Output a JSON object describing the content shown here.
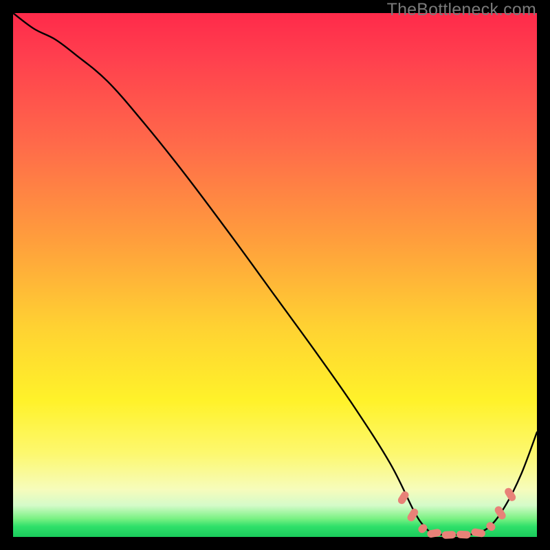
{
  "watermark": "TheBottleneck.com",
  "chart_data": {
    "type": "line",
    "title": "",
    "xlabel": "",
    "ylabel": "",
    "xlim": [
      0,
      100
    ],
    "ylim": [
      0,
      100
    ],
    "grid": false,
    "legend": false,
    "background": "rainbow-gradient-red-to-green",
    "series": [
      {
        "name": "bottleneck-curve",
        "color": "#000000",
        "x": [
          0,
          4,
          8,
          12,
          18,
          25,
          33,
          42,
          50,
          58,
          65,
          72,
          76.5,
          78.5,
          80,
          82,
          85,
          88,
          91,
          94,
          97,
          100
        ],
        "y": [
          100,
          97,
          95,
          92,
          87,
          79,
          69,
          57,
          46,
          35,
          25,
          14,
          5,
          2,
          0.8,
          0.4,
          0.4,
          0.6,
          2,
          6,
          12,
          20
        ]
      }
    ],
    "markers": {
      "name": "dash-markers",
      "color": "#e88278",
      "style": "capsule",
      "points": [
        {
          "x": 74.5,
          "y": 7.5,
          "angle": -58,
          "len": 2.6
        },
        {
          "x": 76.3,
          "y": 4.2,
          "angle": -58,
          "len": 2.6
        },
        {
          "x": 78.2,
          "y": 1.6,
          "angle": -45,
          "len": 1.8
        },
        {
          "x": 80.4,
          "y": 0.7,
          "angle": -10,
          "len": 2.7
        },
        {
          "x": 83.2,
          "y": 0.4,
          "angle": -3,
          "len": 2.7
        },
        {
          "x": 86.0,
          "y": 0.45,
          "angle": 3,
          "len": 2.7
        },
        {
          "x": 88.8,
          "y": 0.8,
          "angle": 10,
          "len": 2.7
        },
        {
          "x": 91.2,
          "y": 2.0,
          "angle": 40,
          "len": 1.8
        },
        {
          "x": 93.0,
          "y": 4.6,
          "angle": 58,
          "len": 2.7
        },
        {
          "x": 94.9,
          "y": 8.1,
          "angle": 58,
          "len": 2.7
        }
      ]
    }
  }
}
